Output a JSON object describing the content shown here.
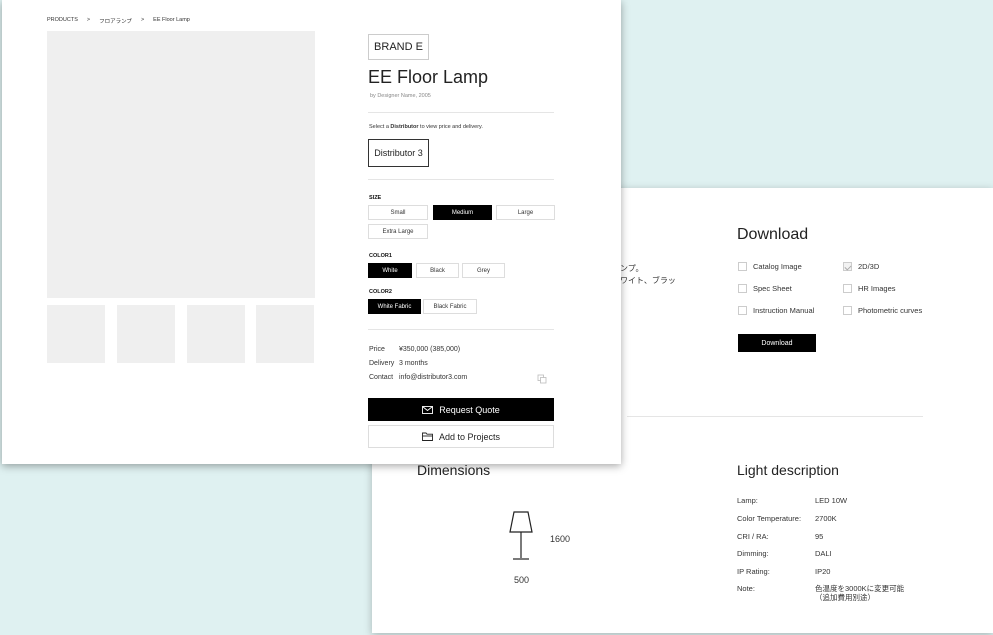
{
  "back": {
    "jp_fragment_1": "ンプ。",
    "jp_fragment_2": "ワイト、ブラッ",
    "download_title": "Download",
    "download_items": [
      {
        "label": "Catalog Image",
        "checked": false
      },
      {
        "label": "2D/3D",
        "checked": true
      },
      {
        "label": "Spec Sheet",
        "checked": false
      },
      {
        "label": "HR Images",
        "checked": false
      },
      {
        "label": "Instruction Manual",
        "checked": false
      },
      {
        "label": "Photometric curves",
        "checked": false
      }
    ],
    "download_button": "Download",
    "dimensions_title": "Dimensions",
    "dim_height": "1600",
    "dim_width": "500",
    "light_title": "Light description",
    "specs": [
      {
        "key": "Lamp:",
        "value": "LED 10W"
      },
      {
        "key": "Color Temperature:",
        "value": "2700K"
      },
      {
        "key": "CRI / RA:",
        "value": "95"
      },
      {
        "key": "Dimming:",
        "value": "DALI"
      },
      {
        "key": "IP Rating:",
        "value": "IP20"
      },
      {
        "key": "Note:",
        "value": "色温度を3000Kに変更可能\n（追加費用別途）"
      }
    ]
  },
  "front": {
    "breadcrumb": [
      "PRODUCTS",
      ">",
      "フロアランプ",
      ">",
      "EE Floor Lamp"
    ],
    "brand": "BRAND E",
    "title": "EE Floor Lamp",
    "designer": "by  Designer Name, 2005",
    "select_prefix": "Select a ",
    "select_bold": "Distributor",
    "select_suffix": " to view price and delivery.",
    "distributor": "Distributor 3",
    "size_label": "SIZE",
    "sizes": [
      "Small",
      "Medium",
      "Large",
      "Extra Large"
    ],
    "size_selected": "Medium",
    "color1_label": "COLOR1",
    "color1_options": [
      "White",
      "Black",
      "Grey"
    ],
    "color1_selected": "White",
    "color2_label": "COLOR2",
    "color2_options": [
      "White Fabric",
      "Black Fabric"
    ],
    "color2_selected": "White Fabric",
    "info": [
      {
        "key": "Price",
        "value": "¥350,000 (385,000)"
      },
      {
        "key": "Delivery",
        "value": "3 months"
      },
      {
        "key": "Contact",
        "value": "info@distributor3.com"
      }
    ],
    "request_quote": "Request Quote",
    "add_to_projects": "Add to Projects"
  },
  "colors": {
    "background": "#dff1f1",
    "accent": "#000000",
    "placeholder": "#efefef"
  }
}
